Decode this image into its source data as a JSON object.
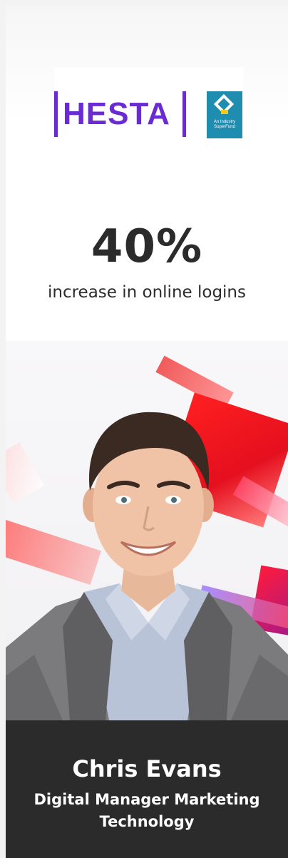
{
  "logo": {
    "brand_text": "HESTA",
    "badge_text": "An Industry SuperFund",
    "brand_color": "#6a2bd3",
    "badge_color": "#1f8db0"
  },
  "stat": {
    "value": "40%",
    "label": "increase in online logins"
  },
  "photo": {
    "subject": "portrait-photo",
    "background_accent_color": "#e50f1e"
  },
  "caption": {
    "name": "Chris Evans",
    "role": "Digital Manager Marketing Technology",
    "background_color": "#2b2b2b"
  }
}
